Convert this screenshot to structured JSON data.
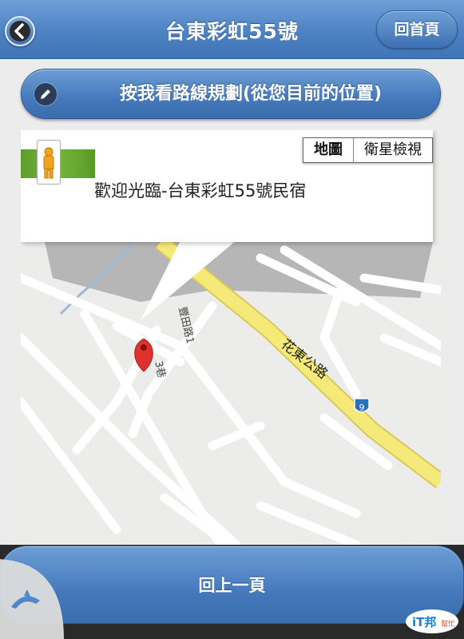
{
  "header": {
    "title": "台東彩虹55號",
    "home_label": "回首頁"
  },
  "route_button": {
    "label": "按我看路線規劃(從您目前的位置)"
  },
  "map": {
    "infowindow_text": "歡迎光臨-台東彩虹55號民宿",
    "map_types": [
      "地圖",
      "衛星檢視"
    ],
    "active_map_type": "地圖",
    "road_labels": {
      "main_road": "花東公路",
      "side_road": "豐田路1",
      "lane": "3巷",
      "route_shield": "9"
    },
    "colors": {
      "main_road": "#f5e97a",
      "minor_road": "#ffffff",
      "river": "#9fb7d8",
      "marker": "#e0322d",
      "shield": "#2b6fc2"
    }
  },
  "footer": {
    "back_label": "回上一頁"
  },
  "watermark": {
    "brand": "iT邦",
    "sub": "幫忙"
  },
  "icons": {
    "back": "chevron-left-icon",
    "route": "pencil-icon",
    "pegman": "pegman-icon",
    "marker": "map-pin-icon",
    "dolphin": "dolphin-icon"
  }
}
